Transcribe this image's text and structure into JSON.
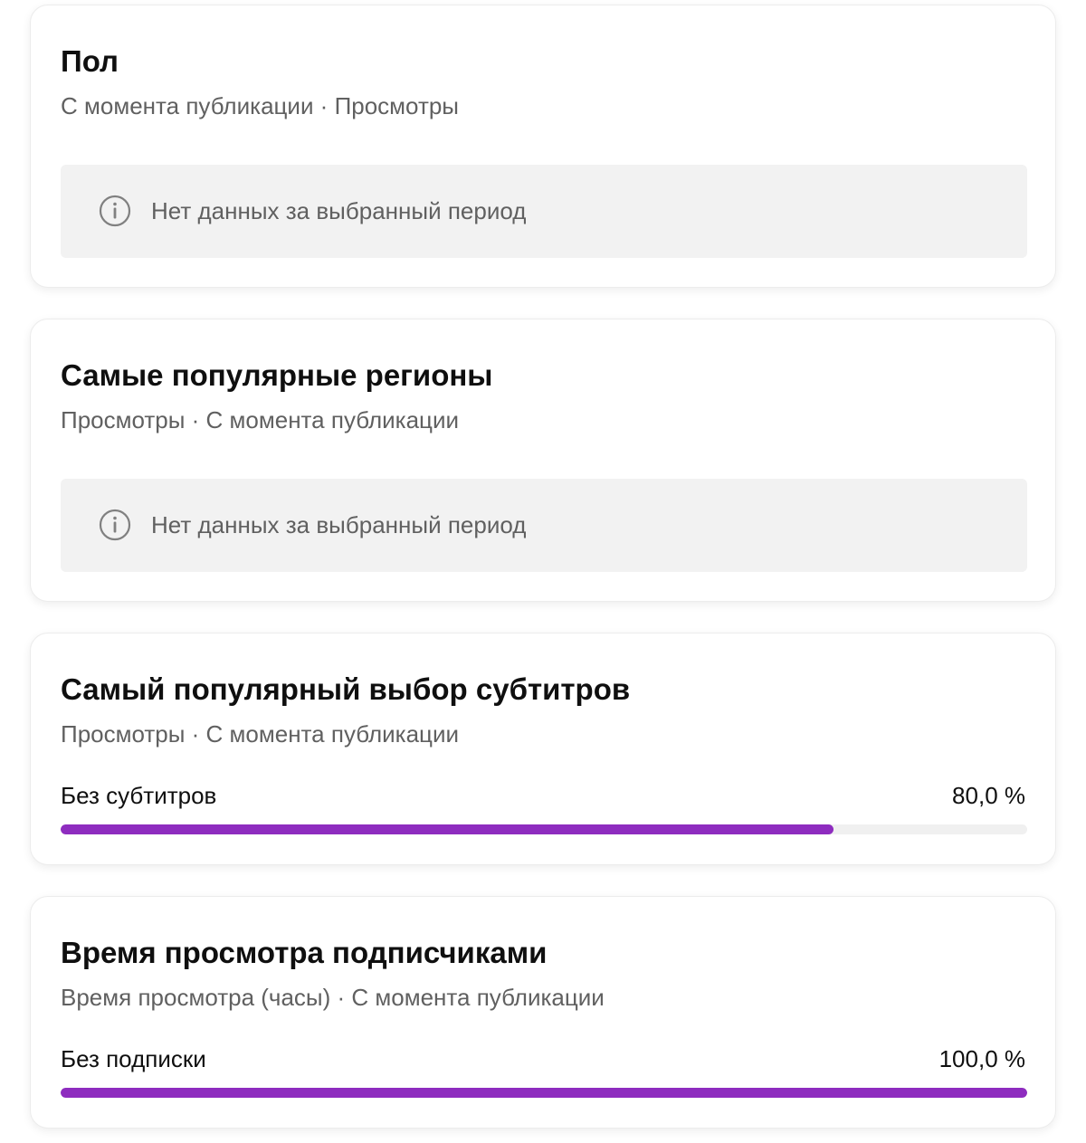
{
  "accent_color": "#8e2cbf",
  "cards": [
    {
      "title": "Пол",
      "subtitle": "С момента публикации · Просмотры",
      "empty_message": "Нет данных за выбранный период",
      "icon": "info-icon"
    },
    {
      "title": "Самые популярные регионы",
      "subtitle": "Просмотры · С момента публикации",
      "empty_message": "Нет данных за выбранный период",
      "icon": "info-icon"
    },
    {
      "title": "Самый популярный выбор субтитров",
      "subtitle": "Просмотры · С момента публикации",
      "rows": [
        {
          "label": "Без субтитров",
          "value": "80,0 %",
          "fraction": 0.8
        }
      ]
    },
    {
      "title": "Время просмотра подписчиками",
      "subtitle": "Время просмотра (часы) · С момента публикации",
      "rows": [
        {
          "label": "Без подписки",
          "value": "100,0 %",
          "fraction": 1.0
        }
      ]
    }
  ]
}
